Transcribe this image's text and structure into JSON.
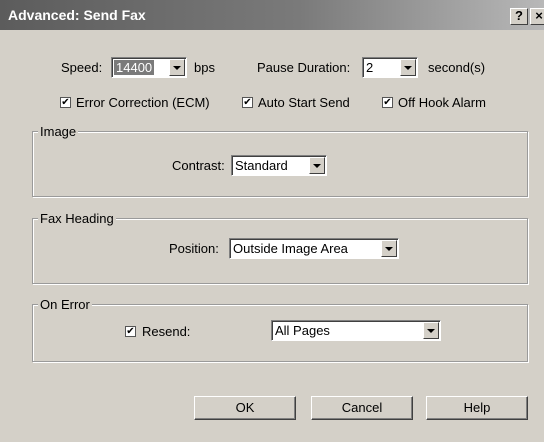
{
  "window": {
    "title": "Advanced: Send Fax",
    "help_label": "?",
    "close_label": "×"
  },
  "speed": {
    "label": "Speed:",
    "value": "14400",
    "unit": "bps"
  },
  "pause": {
    "label": "Pause Duration:",
    "value": "2",
    "unit": "second(s)"
  },
  "options": {
    "ecm": {
      "label": "Error Correction (ECM)",
      "checked": true
    },
    "auto_start": {
      "label": "Auto Start Send",
      "checked": true
    },
    "off_hook": {
      "label": "Off Hook Alarm",
      "checked": true
    }
  },
  "image": {
    "title": "Image",
    "contrast_label": "Contrast:",
    "contrast_value": "Standard"
  },
  "fax_heading": {
    "title": "Fax Heading",
    "position_label": "Position:",
    "position_value": "Outside Image Area"
  },
  "on_error": {
    "title": "On Error",
    "resend_label": "Resend:",
    "resend_checked": true,
    "resend_value": "All Pages"
  },
  "buttons": {
    "ok": "OK",
    "cancel": "Cancel",
    "help": "Help"
  },
  "check_glyph": "✔",
  "colors": {
    "title_bar": "#5c5c5c",
    "dialog_bg": "#d4d0c8",
    "selection": "#7a7a7a"
  }
}
